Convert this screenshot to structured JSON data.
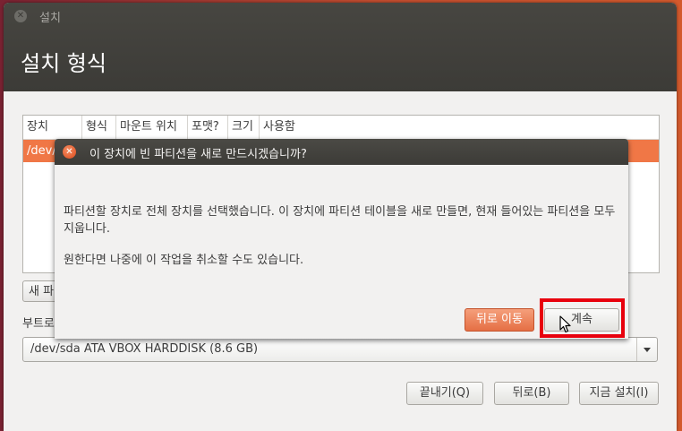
{
  "window": {
    "app_title": "설치",
    "page_title": "설치 형식"
  },
  "table": {
    "columns": [
      "장치",
      "형식",
      "마운트 위치",
      "포맷?",
      "크기",
      "사용함"
    ],
    "selected_row": "/dev/sda"
  },
  "buttons": {
    "new_partition": "새 파",
    "quit": "끝내기(Q)",
    "back": "뒤로(B)",
    "install_now": "지금 설치(I)"
  },
  "boot": {
    "label": "부트로",
    "device": "/dev/sda  ATA VBOX HARDDISK (8.6 GB)"
  },
  "dialog": {
    "title": "이 장치에 빈 파티션을 새로 만드시겠습니까?",
    "message": "파티션할 장치로 전체 장치를 선택했습니다. 이 장치에 파티션 테이블을 새로 만들면, 현재 들어있는 파티션을 모두 지웁니다.",
    "message2": "원한다면 나중에 이 작업을 취소할 수도 있습니다.",
    "back_label": "뒤로 이동",
    "continue_label": "계속"
  },
  "colors": {
    "accent": "#f07746",
    "titlebar": "#3c3b37",
    "highlight": "#e8000d"
  },
  "icons": {
    "window_close": "close-icon",
    "dialog_close": "close-icon",
    "dropdown": "chevron-down-icon",
    "pointer": "cursor-icon"
  }
}
